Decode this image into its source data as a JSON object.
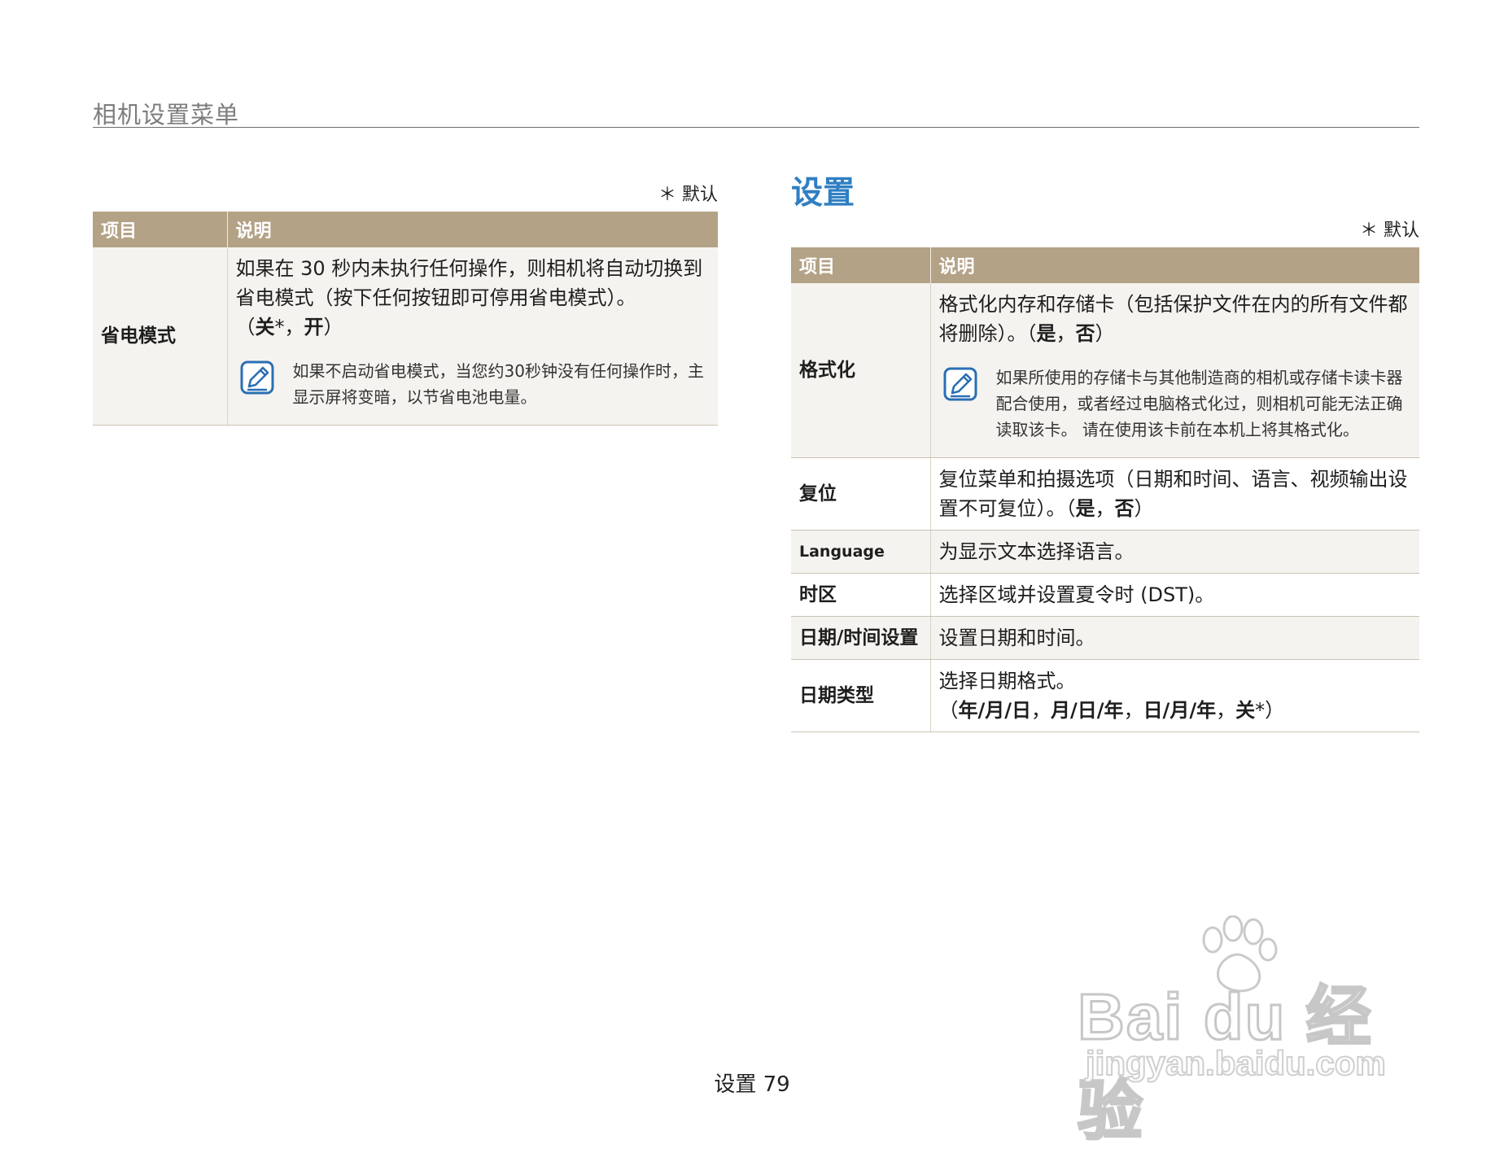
{
  "header": {
    "title": "相机设置菜单"
  },
  "left": {
    "default_note": "＊ 默认",
    "columns": [
      "项目",
      "说明"
    ],
    "rows": [
      {
        "item": "省电模式",
        "desc": "如果在 30 秒内未执行任何操作，则相机将自动切换到省电模式（按下任何按钮即可停用省电模式）。",
        "opts_prefix": "（",
        "opt1": "关",
        "opt1_suffix": "*，",
        "opt2": "开",
        "opts_suffix": "）",
        "note": "如果不启动省电模式，当您约30秒钟没有任何操作时，主显示屏将变暗，以节省电池电量。"
      }
    ]
  },
  "right": {
    "section_title": "设置",
    "default_note": "＊ 默认",
    "columns": [
      "项目",
      "说明"
    ],
    "rows": [
      {
        "item": "格式化",
        "desc": "格式化内存和存储卡（包括保护文件在内的所有文件都将删除）。（",
        "opt1": "是",
        "sep": "，",
        "opt2": "否",
        "end": "）",
        "note": "如果所使用的存储卡与其他制造商的相机或存储卡读卡器配合使用，或者经过电脑格式化过，则相机可能无法正确读取该卡。 请在使用该卡前在本机上将其格式化。"
      },
      {
        "item": "复位",
        "desc": "复位菜单和拍摄选项（日期和时间、语言、视频输出设置不可复位）。（",
        "opt1": "是",
        "sep": "，",
        "opt2": "否",
        "end": "）"
      },
      {
        "item": "Language",
        "desc": "为显示文本选择语言。"
      },
      {
        "item": "时区",
        "desc": "选择区域并设置夏令时 (DST)。"
      },
      {
        "item": "日期/时间设置",
        "desc": "设置日期和时间。"
      },
      {
        "item": "日期类型",
        "desc": "选择日期格式。",
        "opts_prefix": "（",
        "opt1": "年/月/日",
        "opt2": "月/日/年",
        "opt3": "日/月/年",
        "opt4": "关",
        "sep": "，",
        "opts_suffix": "*）"
      }
    ]
  },
  "footer": {
    "section": "设置",
    "page": "79"
  },
  "watermark": {
    "brand": "Bai du 经验",
    "url": "jingyan.baidu.com"
  },
  "colors": {
    "accent": "#2f7fc3",
    "table_header": "#b4a286",
    "row_shade": "#f5f3ef"
  },
  "icons": {
    "note": "memo-pen-icon"
  }
}
